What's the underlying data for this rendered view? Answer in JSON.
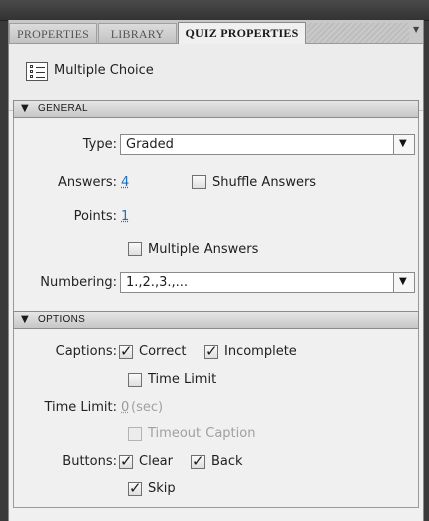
{
  "tabs": [
    "PROPERTIES",
    "LIBRARY",
    "QUIZ PROPERTIES"
  ],
  "panel_menu_icon": "chevron-down",
  "header": {
    "icon": "multiple-choice-icon",
    "title": "Multiple Choice"
  },
  "general": {
    "title": "GENERAL",
    "type_label": "Type:",
    "type_value": "Graded",
    "answers_label": "Answers:",
    "answers_value": "4",
    "shuffle_label": "Shuffle Answers",
    "shuffle_checked": false,
    "points_label": "Points:",
    "points_value": "1",
    "multiple_answers_label": "Multiple Answers",
    "multiple_answers_checked": false,
    "numbering_label": "Numbering:",
    "numbering_value": "1.,2.,3.,..."
  },
  "options": {
    "title": "OPTIONS",
    "captions_label": "Captions:",
    "correct_label": "Correct",
    "correct_checked": true,
    "incomplete_label": "Incomplete",
    "incomplete_checked": true,
    "time_limit_cb_label": "Time Limit",
    "time_limit_cb_checked": false,
    "time_limit_label": "Time Limit:",
    "time_limit_value": "0",
    "time_limit_unit": "(sec)",
    "timeout_caption_label": "Timeout Caption",
    "timeout_caption_checked": false,
    "buttons_label": "Buttons:",
    "clear_label": "Clear",
    "clear_checked": true,
    "back_label": "Back",
    "back_checked": true,
    "skip_label": "Skip",
    "skip_checked": true
  },
  "colors": {
    "link": "#1e6fc0",
    "panel_bg": "#f0f0f0",
    "chrome_bg": "#3a3a3a"
  }
}
